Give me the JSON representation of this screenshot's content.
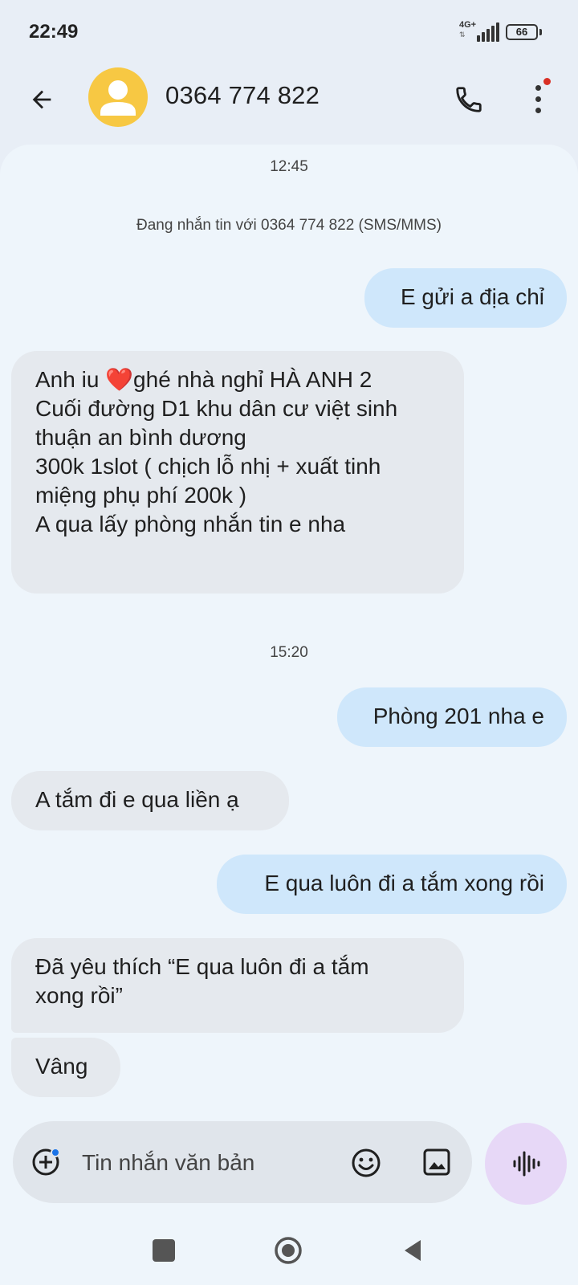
{
  "status_bar": {
    "time": "22:49",
    "network": "4G+",
    "battery": "66"
  },
  "header": {
    "back_icon": "arrow-back-icon",
    "avatar_icon": "person-icon",
    "contact": "0364 774 822",
    "call_icon": "phone-icon",
    "more_icon": "more-vert-icon"
  },
  "conversation": {
    "timestamp_1": "12:45",
    "info": "Đang nhắn tin với 0364 774 822 (SMS/MMS)",
    "msg_1": "E gửi a địa chỉ",
    "msg_2": {
      "line_1_a": "Anh iu ",
      "line_1_heart": "❤️",
      "line_1_b": "ghé nhà nghỉ HÀ ANH 2",
      "line_2": "Cuối đường D1 khu dân cư việt sinh",
      "line_3": "thuận an bình dương",
      "line_4": "300k 1slot ( chịch lỗ nhị + xuất tinh",
      "line_5": "miệng phụ phí 200k )",
      "line_6": "A qua lấy phòng nhắn tin e nha"
    },
    "timestamp_2": "15:20",
    "msg_3": "Phòng 201 nha e",
    "msg_4": "A tắm đi e qua liền ạ",
    "msg_5": "E qua luôn đi a tắm xong rồi",
    "msg_6": {
      "line_1": "Đã yêu thích “E qua luôn đi a tắm",
      "line_2": "xong rồi”"
    },
    "msg_7": "Vâng"
  },
  "composer": {
    "placeholder": "Tin nhắn văn bản",
    "add_icon": "add-circle-icon",
    "emoji_icon": "emoji-icon",
    "gallery_icon": "image-icon",
    "voice_icon": "voice-waveform-icon"
  },
  "colors": {
    "outgoing_bubble": "#cfe7fb",
    "incoming_bubble": "#e5e9ee",
    "avatar": "#f7c843",
    "voice_button": "#e7d8f7",
    "notification_dot": "#d93025"
  }
}
